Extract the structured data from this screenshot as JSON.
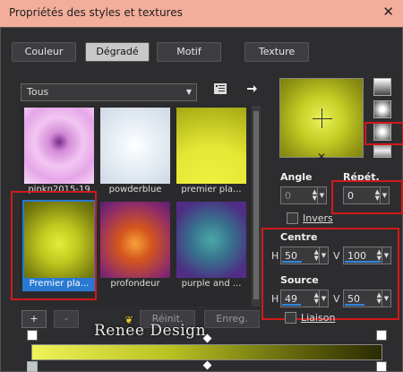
{
  "window": {
    "title": "Propriétés des styles et textures",
    "close": "✕"
  },
  "tabs": [
    {
      "label": "Couleur",
      "active": false
    },
    {
      "label": "Dégradé",
      "active": true
    },
    {
      "label": "Motif",
      "active": false
    },
    {
      "label": "Texture",
      "active": false
    }
  ],
  "category": {
    "value": "Tous"
  },
  "gallery": {
    "items": [
      {
        "label": "pinkn2015-19",
        "selected": false
      },
      {
        "label": "powderblue",
        "selected": false
      },
      {
        "label": "premier pla...",
        "selected": false
      },
      {
        "label": "Premier pla...",
        "selected": true
      },
      {
        "label": "profondeur",
        "selected": false
      },
      {
        "label": "purple and ...",
        "selected": false
      }
    ]
  },
  "gradient": {
    "angle_label": "Angle",
    "angle_value": "0",
    "repeat_label": "Répét.",
    "repeat_value": "0",
    "invert_label": "Invers",
    "center_label": "Centre",
    "center_h_label": "H",
    "center_h": "50",
    "center_v_label": "V",
    "center_v": "100",
    "source_label": "Source",
    "source_h_label": "H",
    "source_h": "49",
    "source_v_label": "V",
    "source_v": "50",
    "link_label": "Liaison"
  },
  "buttons": {
    "add": "+",
    "remove": "-",
    "reset": "Réinit.",
    "save": "Enreg."
  },
  "watermark": "Renee Design",
  "colors": {
    "titlebar": "#f2ae9a",
    "highlight_box": "#d11a1a",
    "selection": "#2979d0",
    "gradient_start": "#eff258",
    "gradient_end": "#2a2a05"
  }
}
